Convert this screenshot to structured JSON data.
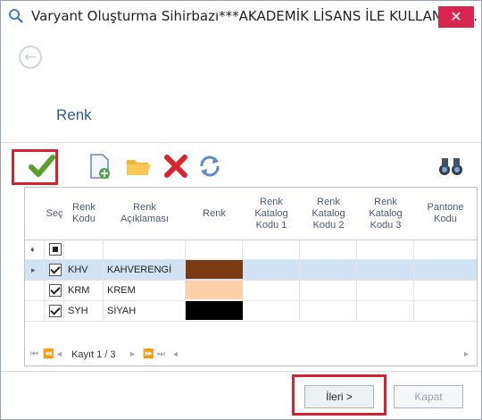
{
  "window": {
    "title": "Varyant Oluşturma Sihirbazı***AKADEMİK LİSANS İLE KULLANILM...",
    "close_label": "✕"
  },
  "page": {
    "section_title": "Renk"
  },
  "toolbar": {
    "icons": [
      "check-icon",
      "new-document-icon",
      "open-folder-icon",
      "delete-icon",
      "refresh-icon",
      "find-binoculars-icon"
    ],
    "colors": {
      "check": "#5aa02c",
      "delete": "#d9262e",
      "folder": "#f2b534",
      "refresh": "#5b8ec7"
    }
  },
  "grid": {
    "columns": [
      "Seç",
      "Renk\nKodu",
      "Renk\nAçıklaması",
      "Renk",
      "Renk\nKatalog\nKodu 1",
      "Renk\nKatalog\nKodu 2",
      "Renk\nKatalog\nKodu 3",
      "Pantone\nKodu"
    ],
    "rows": [
      {
        "selected": true,
        "code": "KHV",
        "desc": "KAHVERENGİ",
        "color": "#7a3b12",
        "current": true
      },
      {
        "selected": true,
        "code": "KRM",
        "desc": "KREM",
        "color": "#ffd0a8",
        "current": false
      },
      {
        "selected": true,
        "code": "SYH",
        "desc": "SİYAH",
        "color": "#000000",
        "current": false
      }
    ]
  },
  "navigator": {
    "record_text": "Kayıt 1 / 3"
  },
  "footer": {
    "next_label": "İleri >",
    "close_label": "Kapat"
  }
}
